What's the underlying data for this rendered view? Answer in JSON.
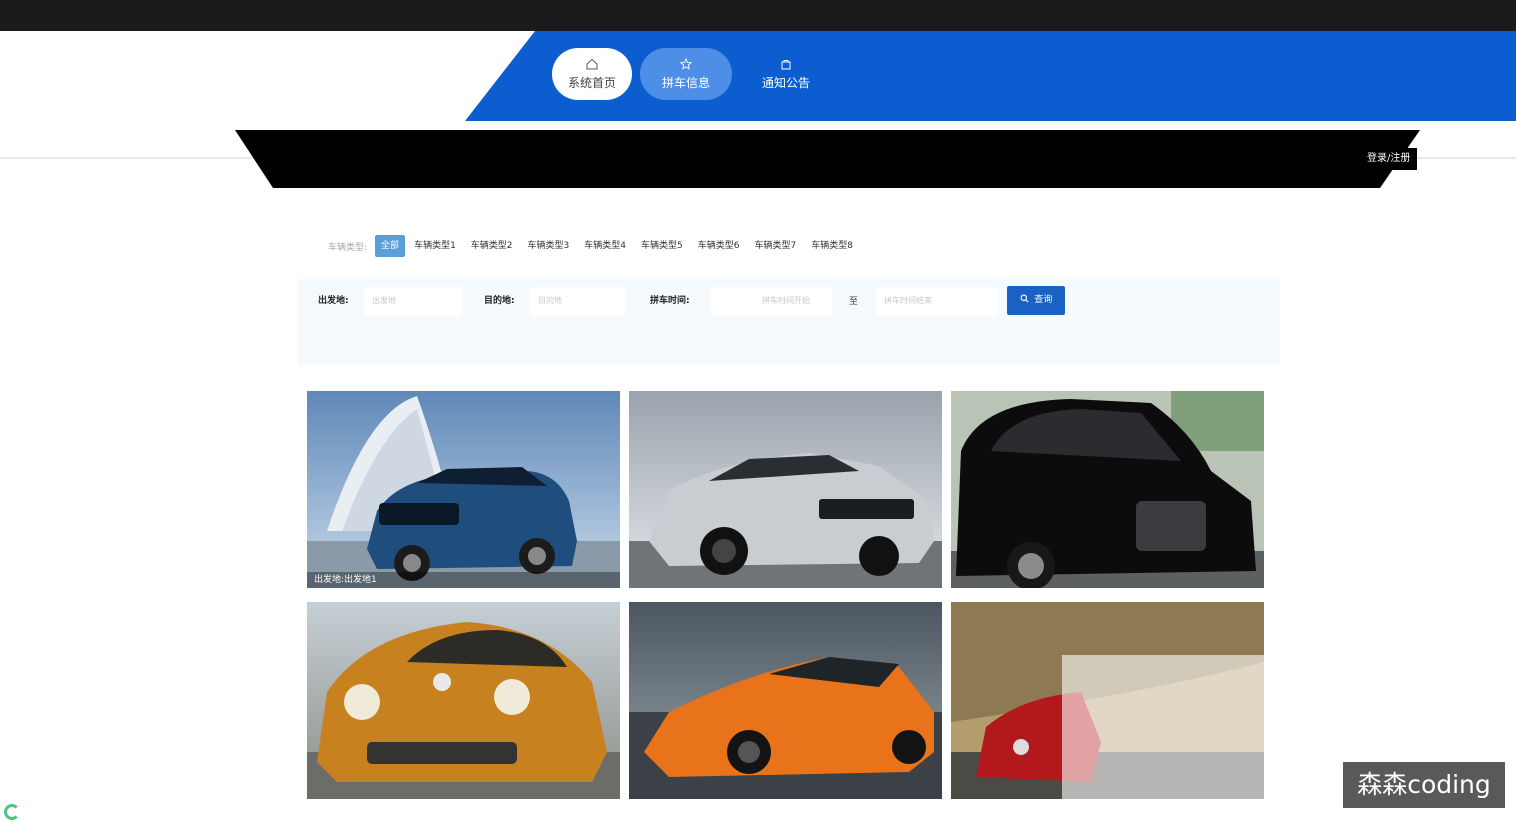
{
  "nav": {
    "items": [
      {
        "label": "系统首页",
        "icon": "home-icon"
      },
      {
        "label": "拼车信息",
        "icon": "star-icon"
      },
      {
        "label": "通知公告",
        "icon": "bag-icon"
      }
    ]
  },
  "header": {
    "login_label": "登录/注册"
  },
  "filters": {
    "type_label": "车辆类型:",
    "types": [
      "全部",
      "车辆类型1",
      "车辆类型2",
      "车辆类型3",
      "车辆类型4",
      "车辆类型5",
      "车辆类型6",
      "车辆类型7",
      "车辆类型8"
    ],
    "selected_type": "全部",
    "origin_label": "出发地:",
    "origin_placeholder": "出发地",
    "destination_label": "目的地:",
    "destination_placeholder": "目的地",
    "time_label": "拼车时间:",
    "time_start_placeholder": "拼车时间开始",
    "time_separator": "至",
    "time_end_placeholder": "拼车时间结束",
    "search_label": "查询"
  },
  "cards": [
    {
      "caption": "出发地:出发地1",
      "scene": "blue-suv"
    },
    {
      "caption": "",
      "scene": "silver-coupe"
    },
    {
      "caption": "",
      "scene": "black-van"
    },
    {
      "caption": "",
      "scene": "yellow-beetle"
    },
    {
      "caption": "",
      "scene": "orange-sedan"
    },
    {
      "caption": "",
      "scene": "red-hatchback"
    }
  ],
  "watermark": "森森coding",
  "colors": {
    "top_bar": "#1b1b1b",
    "nav_blue": "#0c5ed0",
    "nav_active": "#4d8fe6",
    "search_button": "#1a63c4",
    "filter_bg": "#f5faff"
  }
}
